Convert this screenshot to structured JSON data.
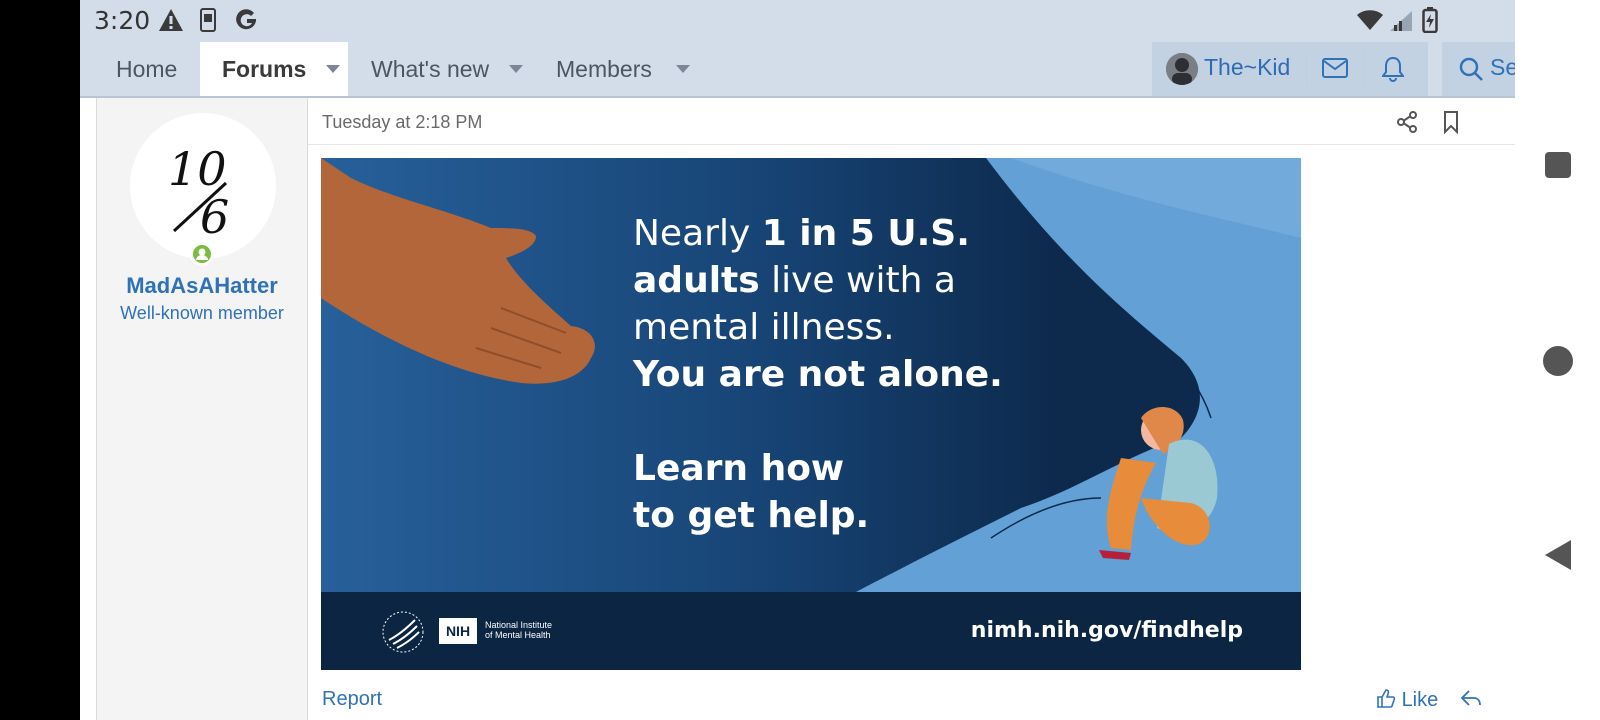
{
  "status_bar": {
    "time": "3:20",
    "icons_left": [
      "warning-icon",
      "phone-icon",
      "google-icon"
    ],
    "icons_right": [
      "wifi-icon",
      "signal-icon",
      "battery-icon"
    ]
  },
  "nav": {
    "items": [
      {
        "label": "Home",
        "active": false,
        "has_dropdown": false
      },
      {
        "label": "Forums",
        "active": true,
        "has_dropdown": true
      },
      {
        "label": "What's new",
        "active": false,
        "has_dropdown": true
      },
      {
        "label": "Members",
        "active": false,
        "has_dropdown": true
      }
    ],
    "user": {
      "name": "The~Kid"
    },
    "search_label": "Se"
  },
  "post": {
    "author": {
      "username": "MadAsAHatter",
      "title": "Well-known member",
      "avatar_text_top": "10",
      "avatar_text_bottom": "6",
      "online": true
    },
    "date": "Tuesday at 2:18 PM",
    "banner": {
      "line1_regular": "Nearly ",
      "line1_bold": "1 in 5 U.S.",
      "line2_bold": "adults",
      "line2_regular": " live with a",
      "line3": "mental illness.",
      "line4": "You are not alone.",
      "line5": "Learn how",
      "line6": "to get help.",
      "org_badge": "NIH",
      "org_name_line1": "National Institute",
      "org_name_line2": "of Mental Health",
      "url": "nimh.nih.gov/findhelp"
    },
    "footer": {
      "report_label": "Report",
      "like_label": "Like"
    }
  },
  "colors": {
    "nav_bg": "#d3dde9",
    "link_blue": "#2f72b8",
    "banner_dark": "#0b2543",
    "banner_mid": "#1f5a93",
    "banner_light": "#62a0d6",
    "online_green": "#7cbb42"
  }
}
